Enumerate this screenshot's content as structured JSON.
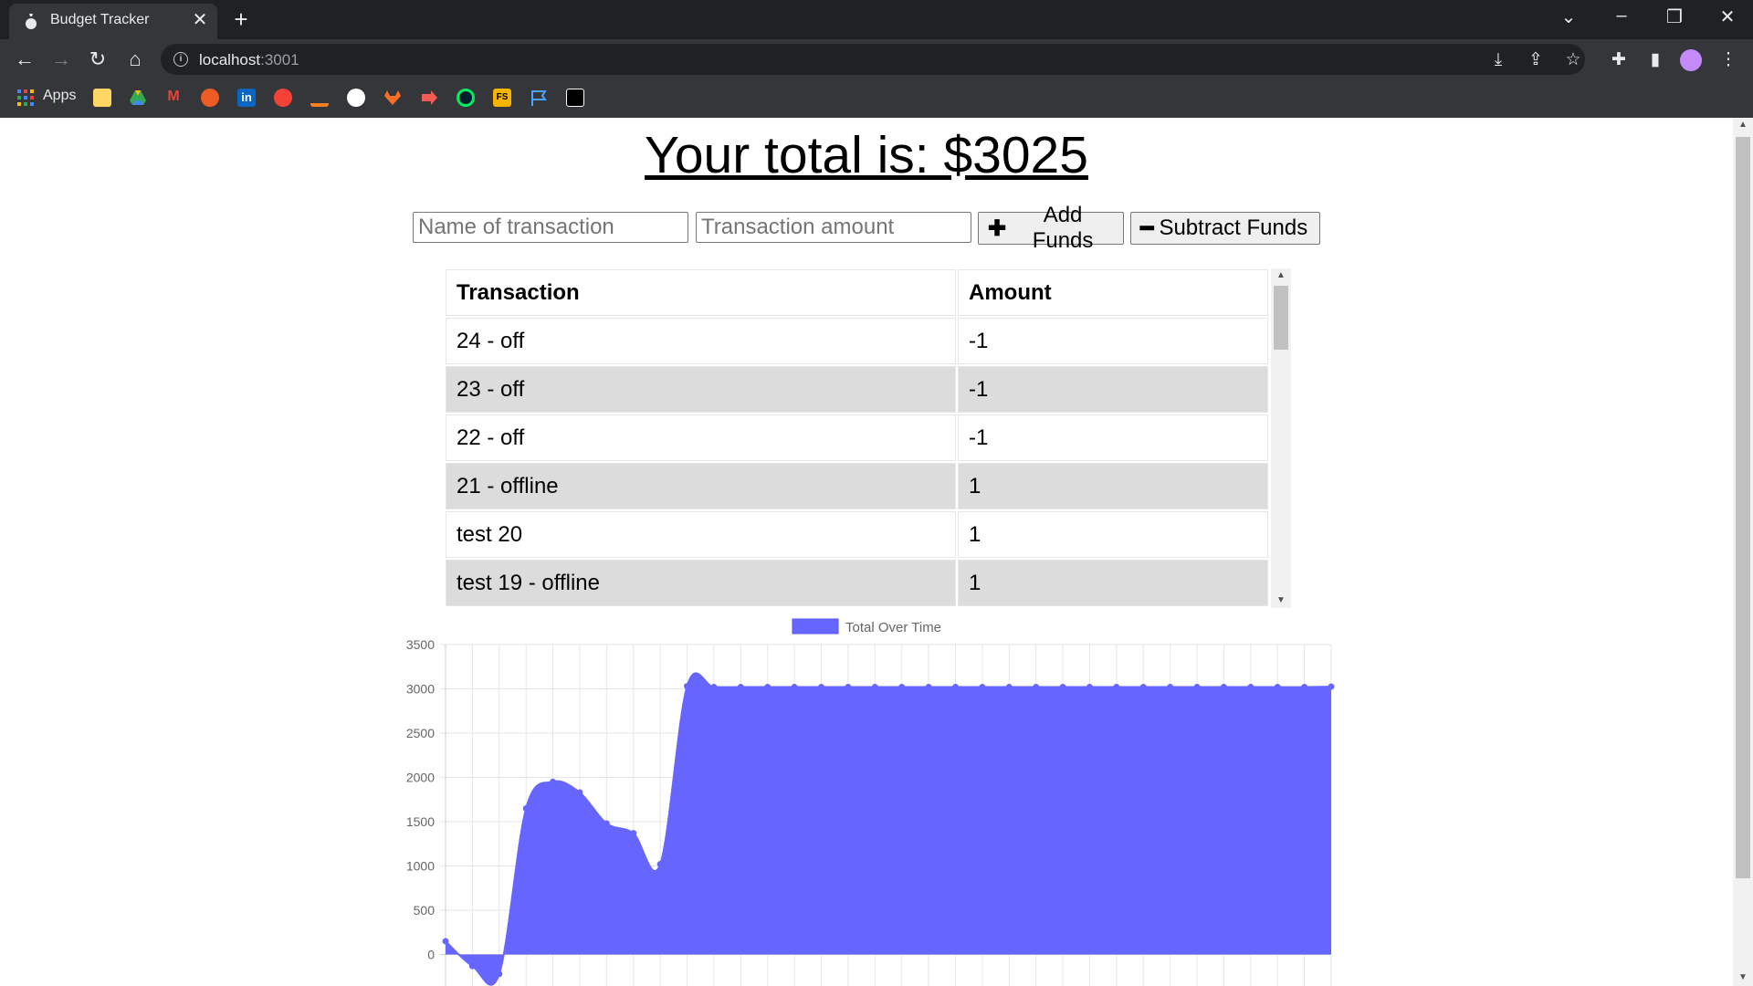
{
  "browser": {
    "tab_title": "Budget Tracker",
    "url_host": "localhost",
    "url_port": ":3001",
    "bookmarks_apps_label": "Apps",
    "bookmark_icons": [
      "apps-grid-icon",
      "folder-icon",
      "google-drive-icon",
      "gmail-icon",
      "postman-icon",
      "linkedin-icon",
      "bug-icon",
      "stackoverflow-icon",
      "github-icon",
      "gitlab-icon",
      "arrow-bookmark-icon",
      "mongodb-icon",
      "fs-icon",
      "flag-icon",
      "black-bookmark-icon"
    ]
  },
  "page": {
    "total_text": "Your total is: $3025",
    "name_placeholder": "Name of transaction",
    "amount_placeholder": "Transaction amount",
    "add_label": "Add Funds",
    "subtract_label": "Subtract Funds",
    "table": {
      "headers": [
        "Transaction",
        "Amount"
      ],
      "rows": [
        [
          "24 - off",
          "-1"
        ],
        [
          "23 - off",
          "-1"
        ],
        [
          "22 - off",
          "-1"
        ],
        [
          "21 - offline",
          "1"
        ],
        [
          "test 20",
          "1"
        ],
        [
          "test 19 - offline",
          "1"
        ]
      ]
    }
  },
  "chart_data": {
    "type": "area",
    "legend": [
      "Total Over Time"
    ],
    "legend_placement": "top-center",
    "grid": true,
    "fill_color": "#6666ff",
    "ylim": [
      -500,
      3500
    ],
    "yticks": [
      3500,
      3000,
      2500,
      2000,
      1500,
      1000,
      500,
      0
    ],
    "series": [
      {
        "name": "Total Over Time",
        "values": [
          150,
          -130,
          -220,
          1650,
          1950,
          1830,
          1480,
          1370,
          1020,
          3030,
          3020,
          3020,
          3020,
          3020,
          3020,
          3020,
          3020,
          3020,
          3020,
          3020,
          3020,
          3020,
          3020,
          3020,
          3020,
          3020,
          3020,
          3020,
          3020,
          3020,
          3020,
          3020,
          3020,
          3025
        ]
      }
    ]
  }
}
